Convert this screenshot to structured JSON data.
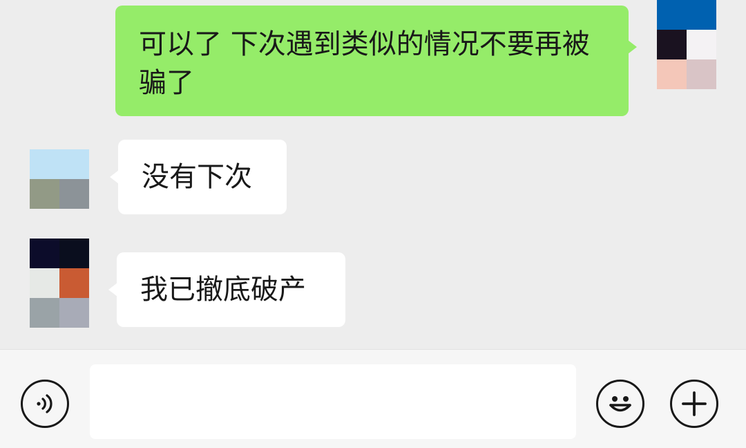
{
  "app": {
    "background": "#ededed"
  },
  "messages": [
    {
      "side": "outgoing",
      "text": "可以了 下次遇到类似的情况不要再被骗了",
      "bubble_color": "#95ec69"
    },
    {
      "side": "incoming",
      "text": "没有下次",
      "bubble_color": "#ffffff"
    },
    {
      "side": "incoming",
      "text": "我已撤底破产",
      "bubble_color": "#ffffff"
    }
  ],
  "avatars": {
    "self": {
      "pixels": [
        "#0061b0",
        "#0061b0",
        "#1a1220",
        "#f4f2f4",
        "#f4c7b9",
        "#d9c4c6"
      ]
    },
    "friend_1": {
      "pixels": [
        "#ededed",
        "#ededed",
        "#bfe2f6",
        "#bfe2f6",
        "#929a86",
        "#8c9398"
      ]
    },
    "friend_2": {
      "pixels": [
        "#0c0c2a",
        "#0a0e1e",
        "#e6e9e6",
        "#c95b33",
        "#9aa3a7",
        "#a8abb7"
      ]
    }
  },
  "input_bar": {
    "voice_icon": "voice-icon",
    "emoji_icon": "emoji-icon",
    "plus_icon": "plus-icon",
    "placeholder": ""
  }
}
